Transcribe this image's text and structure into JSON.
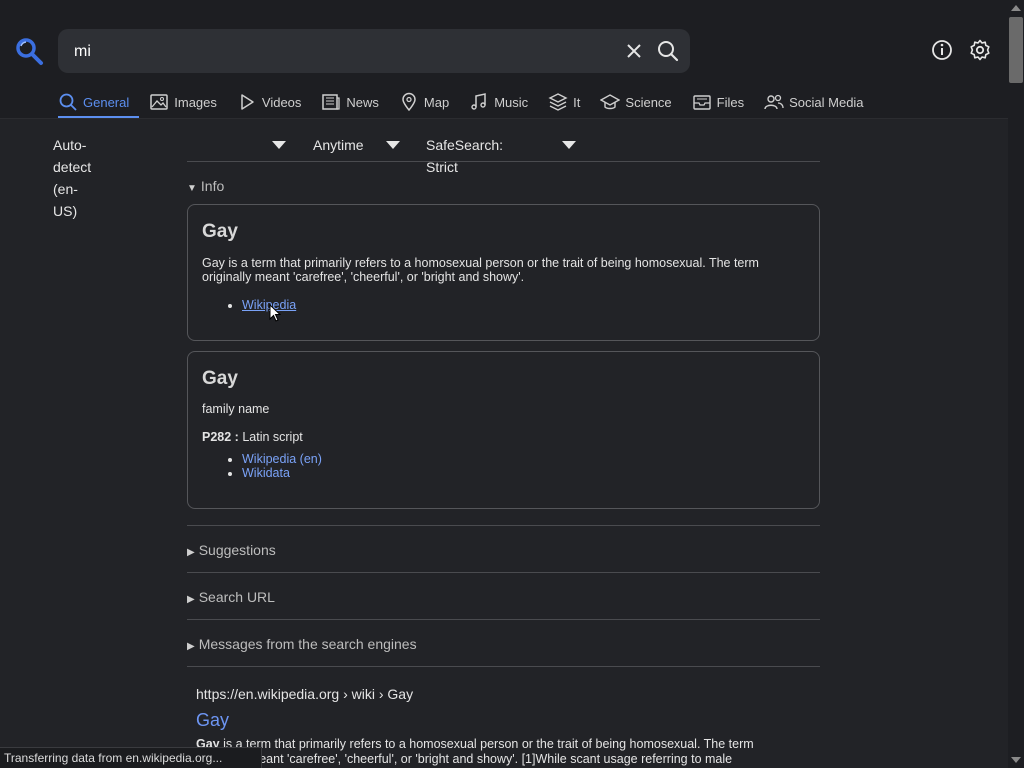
{
  "search": {
    "query": "mi",
    "placeholder": ""
  },
  "header": {
    "logo_icon": "magnifier-logo-icon",
    "clear_icon": "close-icon",
    "search_icon": "search-icon",
    "info_icon": "info-icon",
    "settings_icon": "gear-icon"
  },
  "tabs": [
    {
      "label": "General",
      "icon": "search-icon",
      "active": true
    },
    {
      "label": "Images",
      "icon": "image-icon"
    },
    {
      "label": "Videos",
      "icon": "play-icon"
    },
    {
      "label": "News",
      "icon": "newspaper-icon"
    },
    {
      "label": "Map",
      "icon": "map-pin-icon"
    },
    {
      "label": "Music",
      "icon": "music-note-icon"
    },
    {
      "label": "It",
      "icon": "layers-icon"
    },
    {
      "label": "Science",
      "icon": "graduation-cap-icon"
    },
    {
      "label": "Files",
      "icon": "inbox-icon"
    },
    {
      "label": "Social Media",
      "icon": "people-icon"
    }
  ],
  "filters": {
    "language": "Auto-detect (en-US)",
    "time": "Anytime",
    "safesearch": "SafeSearch: Strict"
  },
  "info_section": {
    "label": "Info"
  },
  "infobox1": {
    "title": "Gay",
    "description": "Gay is a term that primarily refers to a homosexual person or the trait of being homosexual. The term originally meant 'carefree', 'cheerful', or 'bright and showy'.",
    "links": [
      "Wikipedia"
    ]
  },
  "infobox2": {
    "title": "Gay",
    "subtitle": "family name",
    "property_key": "P282 :",
    "property_value": " Latin script",
    "links": [
      "Wikipedia (en)",
      "Wikidata"
    ]
  },
  "sections": {
    "suggestions": "Suggestions",
    "search_url": "Search URL",
    "messages": "Messages from the search engines"
  },
  "result": {
    "url": "https://en.wikipedia.org  › wiki › Gay",
    "title": "Gay",
    "snippet_bold": "Gay",
    "snippet": " is a term that primarily refers to a homosexual person or the trait of being homosexual. The term originally meant 'carefree', 'cheerful', or 'bright and showy'. [1]While scant usage referring to male"
  },
  "status": {
    "text": "Transferring data from en.wikipedia.org..."
  },
  "colors": {
    "accent": "#5c8ff0",
    "link": "#7aa2f7",
    "background": "#222327"
  }
}
